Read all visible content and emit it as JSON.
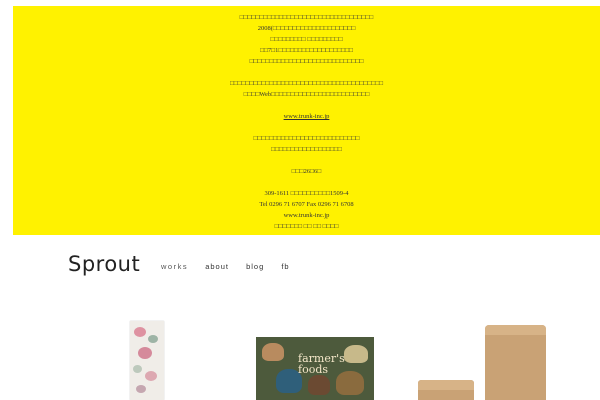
{
  "banner": {
    "background": "#fff200",
    "lines": [
      "□□□□□□□□□□□□□□□□□□□□□□□□□□□□□□□□□□",
      "2008(□□□□□□□□□□□□□□□□□□□□□",
      "□□□□□□□□□ □□□□□□□□□",
      "□□7□1□□□□□□□□□□□□□□□□□□□",
      "□□□□□□□□□□□□□□□□□□□□□□□□□□□□□",
      "",
      "□□□□□□□□□□□□□□□□□□□□□□□□□□□□□□□□□□□□□□□",
      "□□□□Web□□□□□□□□□□□□□□□□□□□□□□□□□",
      "",
      "www.trunk-inc.jp",
      "",
      "□□□□□□□□□□□□□□□□□□□□□□□□□□□",
      "□□□□□□□□□□□□□□□□□□",
      "",
      "□□□26□6□",
      "",
      "309-1611 □□□□□□□□□□1509-4",
      "Tel 0296 71 6707 Fax 0296 71 6708",
      "www.trunk-inc.jp",
      "□□□□□□□ □□ □□ □□□□"
    ]
  },
  "nav": {
    "logo": "Sprout",
    "items": [
      "works",
      "about",
      "blog",
      "fb"
    ]
  },
  "gallery": {
    "thumb2_title": "farmer's\nfoods"
  }
}
